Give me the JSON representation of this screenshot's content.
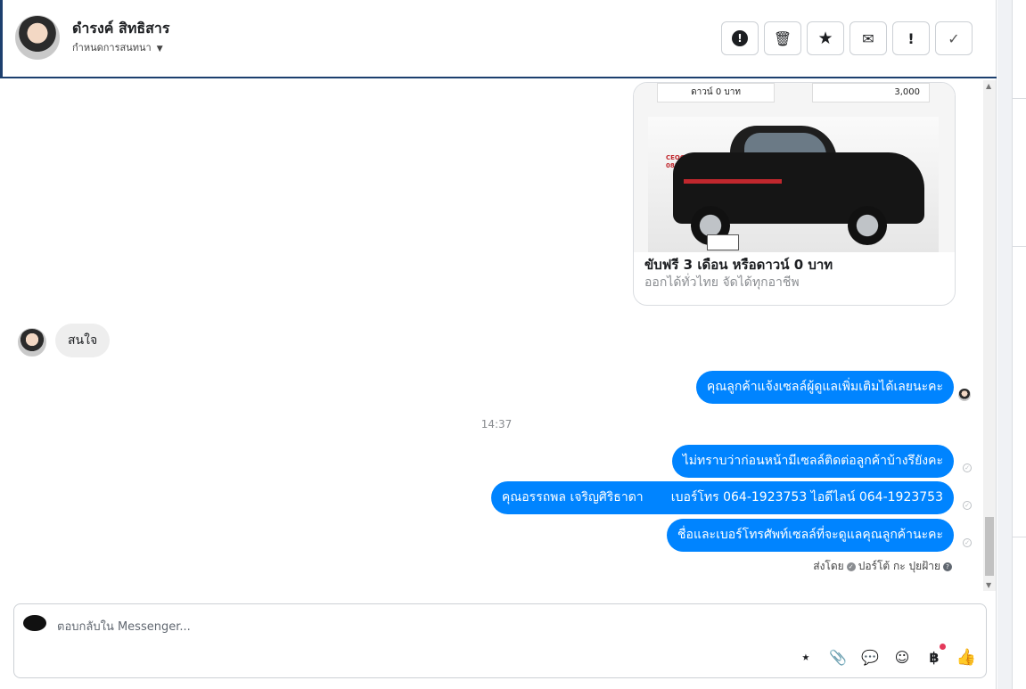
{
  "header": {
    "contact_name": "ดำรงค์ สิทธิสาร",
    "assign_label": "กำหนดการสนทนา"
  },
  "toolbar": {
    "spam_icon": "!",
    "delete_icon": "🗑",
    "star_icon": "★",
    "mail_icon": "✉",
    "follow_icon": "!",
    "done_icon": "✓"
  },
  "card": {
    "top_left_text": "ดาวน์ 0 บาท",
    "top_right_text": "3,000",
    "logo_text": "CEOCAR.COM\n088 567 7832",
    "title": "ขับฟรี 3 เดือน หรือดาวน์ 0 บาท",
    "subtitle": "ออกได้ทั่วไทย จัดได้ทุกอาชีพ"
  },
  "messages": {
    "incoming_1": "สนใจ",
    "outgoing_1": "คุณลูกค้าแจ้งเซลล์ผู้ดูแลเพิ่มเติมได้เลยนะคะ",
    "timestamp": "14:37",
    "outgoing_2": "ไม่ทราบว่าก่อนหน้ามีเซลล์ติดต่อลูกค้าบ้างรึยังคะ",
    "outgoing_3": "คุณอรรถพล เจริญศิริธาดา       เบอร์โทร 064-1923753 ไอดีไลน์ 064-1923753",
    "outgoing_4": "ชื่อและเบอร์โทรศัพท์เซลล์ที่จะดูแลคุณลูกค้านะคะ",
    "sent_by_prefix": "ส่งโดย",
    "sent_by_name": "ปอร์โต้ กะ ปุยฝ้าย"
  },
  "composer": {
    "placeholder": "ตอบกลับใน Messenger..."
  },
  "colors": {
    "accent": "#0084ff",
    "header_border": "#1c3f6e"
  }
}
